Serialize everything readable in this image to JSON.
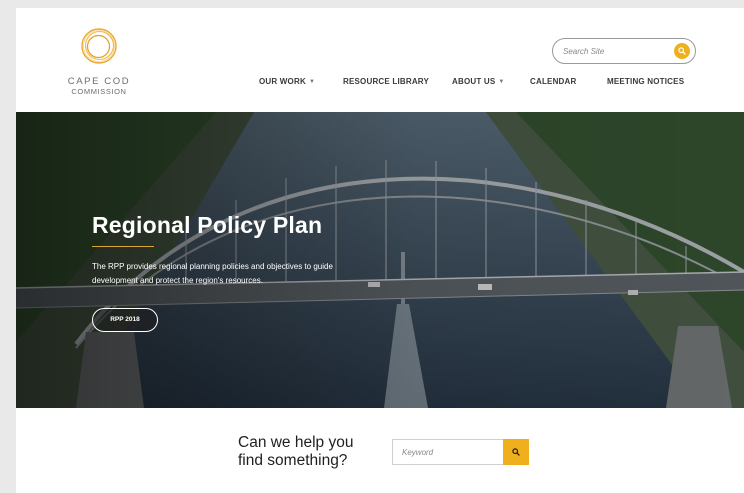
{
  "brand": {
    "line1": "CAPE COD",
    "line2": "COMMISSION",
    "accent_color": "#f0b01e"
  },
  "header_search": {
    "placeholder": "Search Site",
    "button_icon": "search-icon"
  },
  "nav": {
    "items": [
      {
        "label": "OUR WORK",
        "has_dropdown": true
      },
      {
        "label": "RESOURCE LIBRARY",
        "has_dropdown": false
      },
      {
        "label": "ABOUT US",
        "has_dropdown": true
      },
      {
        "label": "CALENDAR",
        "has_dropdown": false
      },
      {
        "label": "MEETING NOTICES",
        "has_dropdown": false
      }
    ]
  },
  "hero": {
    "title": "Regional Policy Plan",
    "body": "The RPP provides regional planning policies and objectives to guide development and protect the region's resources.",
    "button_label": "RPP 2018"
  },
  "help_search": {
    "line1": "Can we help you",
    "line2": "find something?",
    "placeholder": "Keyword",
    "button_icon": "search-icon"
  }
}
